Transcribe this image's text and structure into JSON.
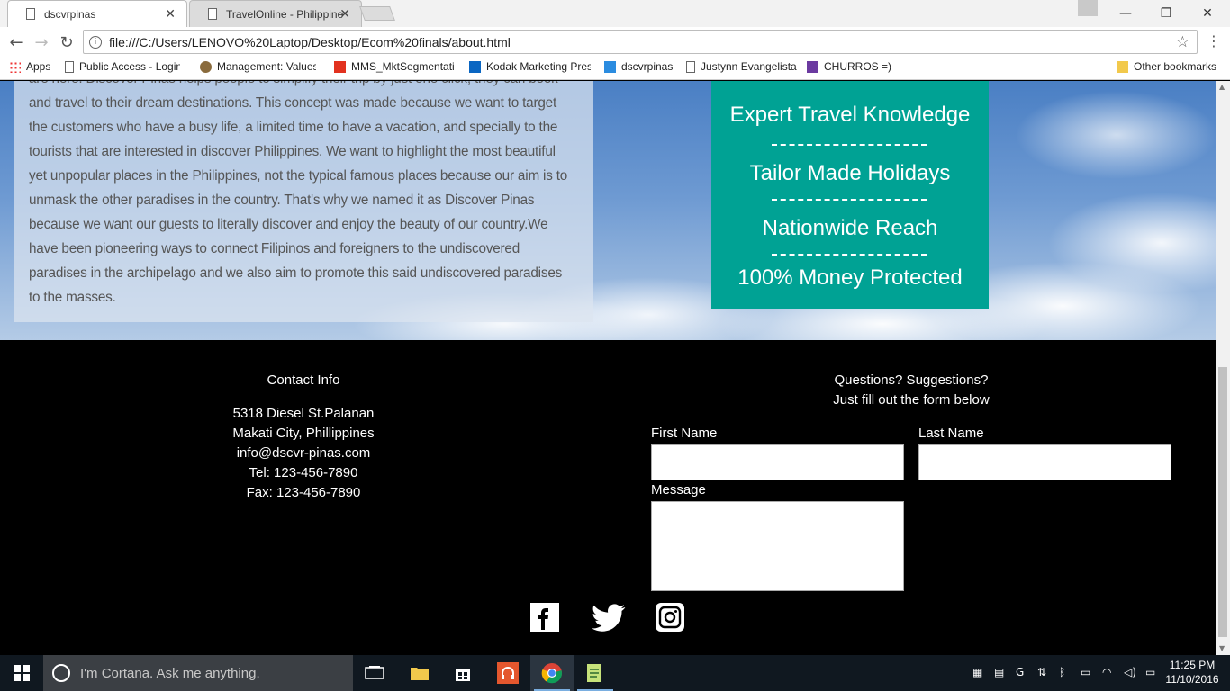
{
  "browser": {
    "tabs": [
      {
        "title": "dscvrpinas",
        "active": true
      },
      {
        "title": "TravelOnline - Philippines",
        "active": false
      }
    ],
    "address": "file:///C:/Users/LENOVO%20Laptop/Desktop/Ecom%20finals/about.html",
    "bookmarks": [
      {
        "label": "Apps",
        "icon": "apps-grid-icon"
      },
      {
        "label": "Public Access - Login",
        "icon": "page-icon"
      },
      {
        "label": "Management: Values",
        "icon": "management-icon"
      },
      {
        "label": "MMS_MktSegmentati",
        "icon": "mms-icon"
      },
      {
        "label": "Kodak Marketing Pres",
        "icon": "linkedin-icon"
      },
      {
        "label": "dscvrpinas",
        "icon": "dscvr-icon"
      },
      {
        "label": "Justynn Evangelista",
        "icon": "page-icon"
      },
      {
        "label": "CHURROS =)",
        "icon": "onenote-icon"
      }
    ],
    "other_bookmarks": "Other bookmarks"
  },
  "about": {
    "lines": [
      "are here. Discover Pinas helps people to simplify their trip by just one click, they can book",
      "and travel to their dream destinations. This concept was made because we want to target",
      "the customers who have a busy life, a limited time to have a vacation, and specially to the",
      "tourists that are interested in discover Philippines. We want to highlight the most beautiful",
      "yet unpopular places in the Philippines, not the typical famous places because our aim is to",
      "unmask the other paradises in the country. That's why we named it as Discover Pinas",
      "because we want our guests to literally discover and enjoy the beauty of our country.We",
      "have been pioneering ways to connect Filipinos and foreigners to the undiscovered",
      "paradises in the archipelago and we also aim to promote this said undiscovered paradises",
      "to the masses."
    ]
  },
  "features": [
    "Expert Travel Knowledge",
    "Tailor Made Holidays",
    "Nationwide Reach",
    "100% Money Protected"
  ],
  "footer": {
    "contact_title": "Contact Info",
    "contact_lines": [
      "5318 Diesel St.Palanan",
      "Makati City, Phillippines",
      "info@dscvr-pinas.com",
      "Tel: 123-456-7890",
      "Fax: 123-456-7890"
    ],
    "questions_title": "Questions? Suggestions?",
    "questions_sub": "Just fill out the form below",
    "first_name_label": "First Name",
    "last_name_label": "Last Name",
    "message_label": "Message",
    "social": [
      "facebook-icon",
      "twitter-icon",
      "instagram-icon"
    ]
  },
  "taskbar": {
    "cortana_placeholder": "I'm Cortana. Ask me anything.",
    "time": "11:25 PM",
    "date": "11/10/2016"
  }
}
